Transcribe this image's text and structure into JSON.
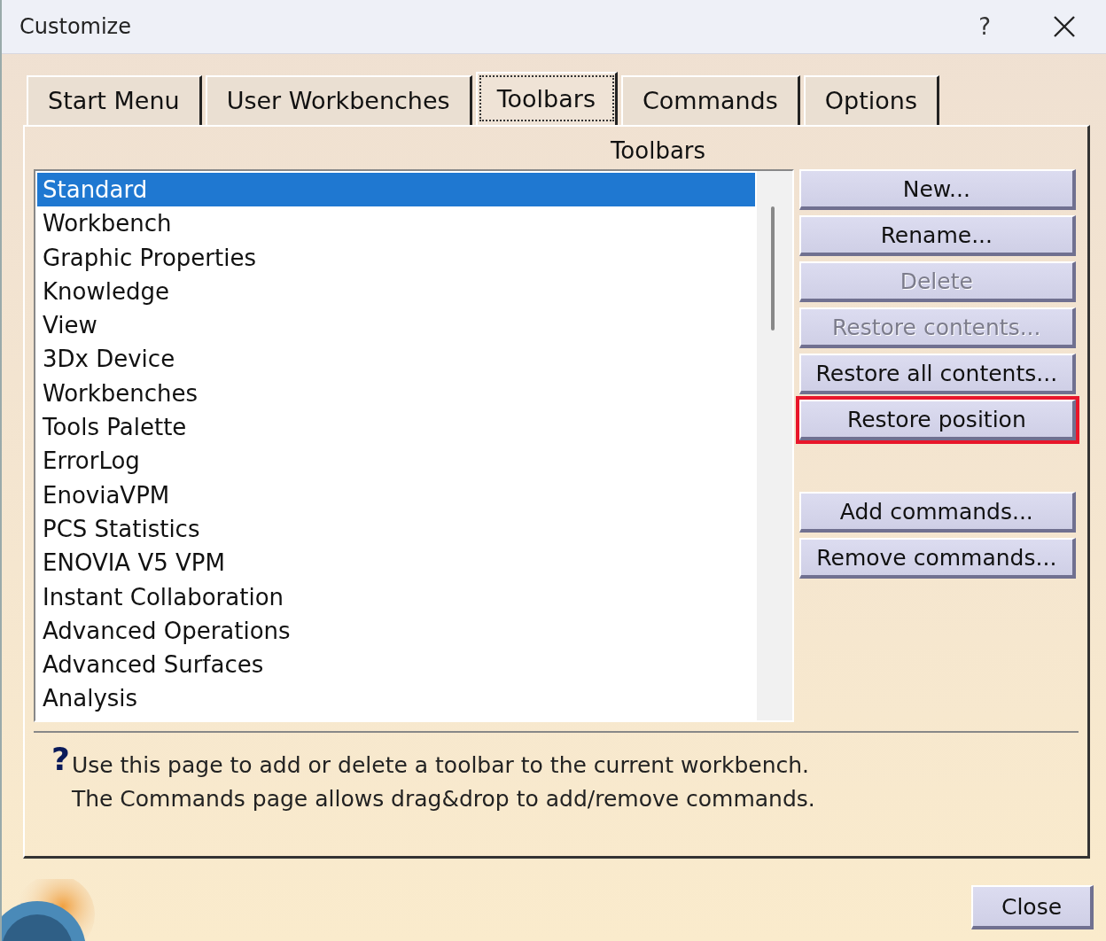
{
  "window": {
    "title": "Customize",
    "help_button": "?"
  },
  "tabs": [
    {
      "label": "Start Menu",
      "selected": false
    },
    {
      "label": "User Workbenches",
      "selected": false
    },
    {
      "label": "Toolbars",
      "selected": true
    },
    {
      "label": "Commands",
      "selected": false
    },
    {
      "label": "Options",
      "selected": false
    }
  ],
  "panel_title": "Toolbars",
  "toolbar_list": [
    {
      "label": "Standard",
      "selected": true
    },
    {
      "label": "Workbench",
      "selected": false
    },
    {
      "label": "Graphic Properties",
      "selected": false
    },
    {
      "label": "Knowledge",
      "selected": false
    },
    {
      "label": "View",
      "selected": false
    },
    {
      "label": "3Dx Device",
      "selected": false
    },
    {
      "label": "Workbenches",
      "selected": false
    },
    {
      "label": "Tools Palette",
      "selected": false
    },
    {
      "label": "ErrorLog",
      "selected": false
    },
    {
      "label": "EnoviaVPM",
      "selected": false
    },
    {
      "label": "PCS Statistics",
      "selected": false
    },
    {
      "label": "ENOVIA V5 VPM",
      "selected": false
    },
    {
      "label": "Instant Collaboration",
      "selected": false
    },
    {
      "label": "Advanced Operations",
      "selected": false
    },
    {
      "label": "Advanced Surfaces",
      "selected": false
    },
    {
      "label": "Analysis",
      "selected": false
    }
  ],
  "toolbar_buttons": [
    {
      "label": "New...",
      "disabled": false,
      "highlighted": false
    },
    {
      "label": "Rename...",
      "disabled": false,
      "highlighted": false
    },
    {
      "label": "Delete",
      "disabled": true,
      "highlighted": false
    },
    {
      "label": "Restore contents...",
      "disabled": true,
      "highlighted": false
    },
    {
      "label": "Restore all contents...",
      "disabled": false,
      "highlighted": false
    },
    {
      "label": "Restore position",
      "disabled": false,
      "highlighted": true
    }
  ],
  "command_buttons": [
    {
      "label": "Add commands...",
      "disabled": false,
      "highlighted": false
    },
    {
      "label": "Remove commands...",
      "disabled": false,
      "highlighted": false
    }
  ],
  "help": {
    "icon": "?",
    "lines": [
      "Use this page to add or delete a toolbar to the current workbench.",
      "The Commands page allows drag&drop to add/remove commands."
    ]
  },
  "close_button": "Close"
}
